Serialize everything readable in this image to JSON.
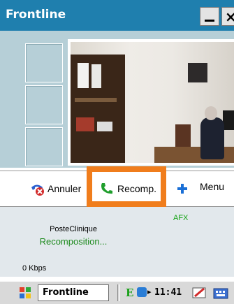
{
  "window": {
    "title": "Frontline",
    "minimize_icon": "minimize-icon",
    "close_label": "×"
  },
  "toolbar": {
    "cancel_label": "Annuler",
    "recomp_label": "Recomp.",
    "menu_label": "Menu",
    "cancel_icon": "hangup-phone-icon",
    "recomp_icon": "green-phone-icon",
    "plus_icon": "plus-icon"
  },
  "status": {
    "codec": "AFX",
    "contact": "PosteClinique",
    "state": "Recomposition...",
    "bandwidth": "0 Kbps"
  },
  "taskbar": {
    "start_icon": "windows-flag-icon",
    "task_label": "Frontline",
    "tray_e": "E",
    "clock": "11:41"
  },
  "colors": {
    "titlebar": "#1f7fae",
    "video_bg": "#b6cfd7",
    "highlight": "#f07d1c",
    "status_green": "#1d8a1d"
  }
}
